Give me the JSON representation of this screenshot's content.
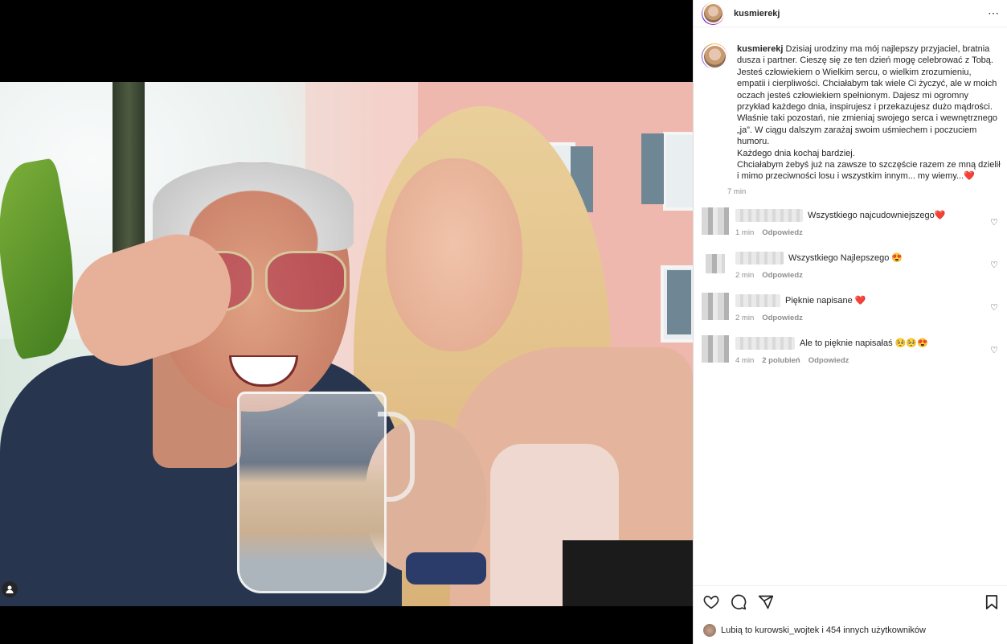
{
  "post": {
    "username": "kusmierekj",
    "more_icon": "⋯",
    "caption_lines": [
      "Dzisiaj urodziny ma mój najlepszy przyjaciel, bratnia dusza i partner. Cieszę się ze ten dzień mogę celebrować z Tobą.",
      "Jesteś człowiekiem o Wielkim sercu, o wielkim zrozumieniu, empatii i cierpliwości. Chciałabym tak wiele Ci życzyć, ale w moich oczach jesteś człowiekiem spełnionym. Dajesz mi ogromny przykład każdego dnia, inspirujesz i przekazujesz dużo mądrości.",
      "Właśnie taki pozostań, nie zmieniaj swojego serca i wewnętrznego „ja”. W ciągu dalszym zarażaj swoim uśmiechem i poczuciem humoru.",
      "Każdego dnia kochaj bardziej.",
      "Chciałabym żebyś już na zawsze to szczęście razem ze mną dzielił i mimo przeciwności losu i wszystkim innym... my wiemy...❤️"
    ],
    "time": "7 min"
  },
  "comments": [
    {
      "text": "Wszystkiego najcudowniejszego❤️",
      "time": "1 min",
      "likes": "",
      "reply": "Odpowiedz",
      "blur_w": 84
    },
    {
      "text": "Wszystkiego Najlepszego 😍",
      "time": "2 min",
      "likes": "",
      "reply": "Odpowiedz",
      "blur_w": 60
    },
    {
      "text": "Pięknie napisane ❤️",
      "time": "2 min",
      "likes": "",
      "reply": "Odpowiedz",
      "blur_w": 56
    },
    {
      "text": "Ale to pięknie napisałaś 🥺🥺😍",
      "time": "4 min",
      "likes": "2 polubień",
      "reply": "Odpowiedz",
      "blur_w": 74
    }
  ],
  "actions": {
    "likes_text": "Lubią to kurowski_wojtek i 454 innych użytkowników"
  },
  "colors": {
    "accent_red": "#ed4956",
    "text": "#262626",
    "muted": "#8e8e8e"
  }
}
